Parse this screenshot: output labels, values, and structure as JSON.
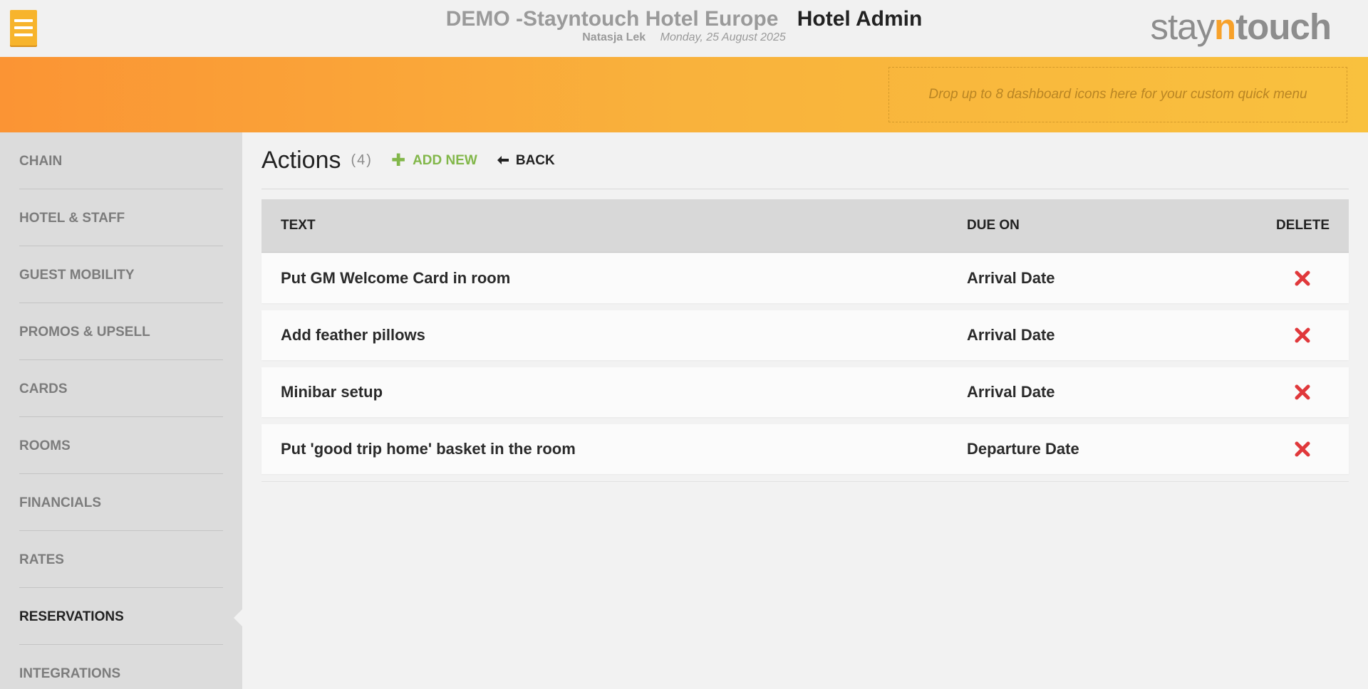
{
  "header": {
    "hotel_name": "DEMO -Stayntouch Hotel Europe",
    "app_name": "Hotel Admin",
    "user_name": "Natasja Lek",
    "date": "Monday, 25 August 2025",
    "logo": {
      "part1": "stay",
      "part2": "n",
      "part3": "touch"
    }
  },
  "quick_menu": {
    "placeholder": "Drop up to 8 dashboard icons here for your custom quick menu"
  },
  "sidebar": {
    "items": [
      {
        "label": "CHAIN"
      },
      {
        "label": "HOTEL & STAFF"
      },
      {
        "label": "GUEST MOBILITY"
      },
      {
        "label": "PROMOS & UPSELL"
      },
      {
        "label": "CARDS"
      },
      {
        "label": "ROOMS"
      },
      {
        "label": "FINANCIALS"
      },
      {
        "label": "RATES"
      },
      {
        "label": "RESERVATIONS"
      },
      {
        "label": "INTEGRATIONS"
      }
    ],
    "active": "RESERVATIONS"
  },
  "page": {
    "title": "Actions",
    "count": "(4)",
    "add_new_label": "ADD NEW",
    "back_label": "BACK"
  },
  "table": {
    "columns": {
      "text": "TEXT",
      "due_on": "DUE ON",
      "delete": "DELETE"
    },
    "rows": [
      {
        "text": "Put GM Welcome Card in room",
        "due_on": "Arrival Date"
      },
      {
        "text": "Add feather pillows",
        "due_on": "Arrival Date"
      },
      {
        "text": "Minibar setup",
        "due_on": "Arrival Date"
      },
      {
        "text": "Put 'good trip home' basket in the room",
        "due_on": "Departure Date"
      }
    ]
  },
  "colors": {
    "accent_orange": "#f9a33a",
    "add_green": "#82b74a",
    "delete_red": "#e0383b"
  },
  "icons": {
    "menu": "hamburger-icon",
    "add": "plus-icon",
    "back": "arrow-left-icon",
    "delete": "close-x-icon"
  }
}
